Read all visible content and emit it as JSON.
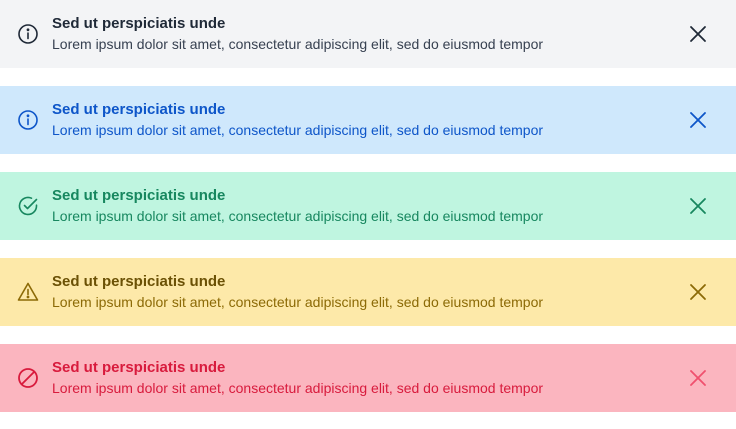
{
  "alerts": [
    {
      "variant": "neutral",
      "icon": "info-icon",
      "title": "Sed ut perspiciatis unde",
      "message": "Lorem ipsum dolor sit amet, consectetur adipiscing elit, sed do eiusmod tempor",
      "background": "#f3f4f6",
      "color": "#1f2937"
    },
    {
      "variant": "info",
      "icon": "info-icon",
      "title": "Sed ut perspiciatis unde",
      "message": "Lorem ipsum dolor sit amet, consectetur adipiscing elit, sed do eiusmod tempor",
      "background": "#cfe8fc",
      "color": "#0e56c9"
    },
    {
      "variant": "success",
      "icon": "check-circle-icon",
      "title": "Sed ut perspiciatis unde",
      "message": "Lorem ipsum dolor sit amet, consectetur adipiscing elit, sed do eiusmod tempor",
      "background": "#bff5e0",
      "color": "#17875f"
    },
    {
      "variant": "warning",
      "icon": "warning-triangle-icon",
      "title": "Sed ut perspiciatis unde",
      "message": "Lorem ipsum dolor sit amet, consectetur adipiscing elit, sed do eiusmod tempor",
      "background": "#fde9a9",
      "color": "#8c6a06"
    },
    {
      "variant": "error",
      "icon": "prohibited-icon",
      "title": "Sed ut perspiciatis unde",
      "message": "Lorem ipsum dolor sit amet, consectetur adipiscing elit, sed do eiusmod tempor",
      "background": "#fbb5bf",
      "color": "#d81b3d"
    }
  ],
  "close_icon": "close-icon"
}
